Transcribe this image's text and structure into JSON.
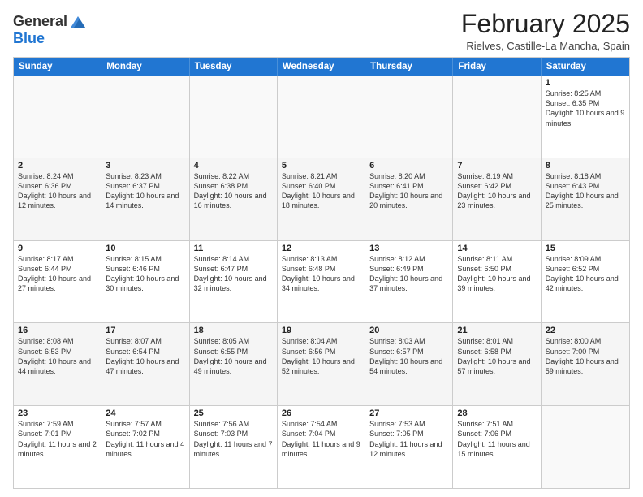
{
  "logo": {
    "general": "General",
    "blue": "Blue"
  },
  "title": "February 2025",
  "location": "Rielves, Castille-La Mancha, Spain",
  "days_of_week": [
    "Sunday",
    "Monday",
    "Tuesday",
    "Wednesday",
    "Thursday",
    "Friday",
    "Saturday"
  ],
  "weeks": [
    {
      "alt": false,
      "cells": [
        {
          "day": "",
          "empty": true,
          "text": ""
        },
        {
          "day": "",
          "empty": true,
          "text": ""
        },
        {
          "day": "",
          "empty": true,
          "text": ""
        },
        {
          "day": "",
          "empty": true,
          "text": ""
        },
        {
          "day": "",
          "empty": true,
          "text": ""
        },
        {
          "day": "",
          "empty": true,
          "text": ""
        },
        {
          "day": "1",
          "empty": false,
          "text": "Sunrise: 8:25 AM\nSunset: 6:35 PM\nDaylight: 10 hours and 9 minutes."
        }
      ]
    },
    {
      "alt": true,
      "cells": [
        {
          "day": "2",
          "empty": false,
          "text": "Sunrise: 8:24 AM\nSunset: 6:36 PM\nDaylight: 10 hours and 12 minutes."
        },
        {
          "day": "3",
          "empty": false,
          "text": "Sunrise: 8:23 AM\nSunset: 6:37 PM\nDaylight: 10 hours and 14 minutes."
        },
        {
          "day": "4",
          "empty": false,
          "text": "Sunrise: 8:22 AM\nSunset: 6:38 PM\nDaylight: 10 hours and 16 minutes."
        },
        {
          "day": "5",
          "empty": false,
          "text": "Sunrise: 8:21 AM\nSunset: 6:40 PM\nDaylight: 10 hours and 18 minutes."
        },
        {
          "day": "6",
          "empty": false,
          "text": "Sunrise: 8:20 AM\nSunset: 6:41 PM\nDaylight: 10 hours and 20 minutes."
        },
        {
          "day": "7",
          "empty": false,
          "text": "Sunrise: 8:19 AM\nSunset: 6:42 PM\nDaylight: 10 hours and 23 minutes."
        },
        {
          "day": "8",
          "empty": false,
          "text": "Sunrise: 8:18 AM\nSunset: 6:43 PM\nDaylight: 10 hours and 25 minutes."
        }
      ]
    },
    {
      "alt": false,
      "cells": [
        {
          "day": "9",
          "empty": false,
          "text": "Sunrise: 8:17 AM\nSunset: 6:44 PM\nDaylight: 10 hours and 27 minutes."
        },
        {
          "day": "10",
          "empty": false,
          "text": "Sunrise: 8:15 AM\nSunset: 6:46 PM\nDaylight: 10 hours and 30 minutes."
        },
        {
          "day": "11",
          "empty": false,
          "text": "Sunrise: 8:14 AM\nSunset: 6:47 PM\nDaylight: 10 hours and 32 minutes."
        },
        {
          "day": "12",
          "empty": false,
          "text": "Sunrise: 8:13 AM\nSunset: 6:48 PM\nDaylight: 10 hours and 34 minutes."
        },
        {
          "day": "13",
          "empty": false,
          "text": "Sunrise: 8:12 AM\nSunset: 6:49 PM\nDaylight: 10 hours and 37 minutes."
        },
        {
          "day": "14",
          "empty": false,
          "text": "Sunrise: 8:11 AM\nSunset: 6:50 PM\nDaylight: 10 hours and 39 minutes."
        },
        {
          "day": "15",
          "empty": false,
          "text": "Sunrise: 8:09 AM\nSunset: 6:52 PM\nDaylight: 10 hours and 42 minutes."
        }
      ]
    },
    {
      "alt": true,
      "cells": [
        {
          "day": "16",
          "empty": false,
          "text": "Sunrise: 8:08 AM\nSunset: 6:53 PM\nDaylight: 10 hours and 44 minutes."
        },
        {
          "day": "17",
          "empty": false,
          "text": "Sunrise: 8:07 AM\nSunset: 6:54 PM\nDaylight: 10 hours and 47 minutes."
        },
        {
          "day": "18",
          "empty": false,
          "text": "Sunrise: 8:05 AM\nSunset: 6:55 PM\nDaylight: 10 hours and 49 minutes."
        },
        {
          "day": "19",
          "empty": false,
          "text": "Sunrise: 8:04 AM\nSunset: 6:56 PM\nDaylight: 10 hours and 52 minutes."
        },
        {
          "day": "20",
          "empty": false,
          "text": "Sunrise: 8:03 AM\nSunset: 6:57 PM\nDaylight: 10 hours and 54 minutes."
        },
        {
          "day": "21",
          "empty": false,
          "text": "Sunrise: 8:01 AM\nSunset: 6:58 PM\nDaylight: 10 hours and 57 minutes."
        },
        {
          "day": "22",
          "empty": false,
          "text": "Sunrise: 8:00 AM\nSunset: 7:00 PM\nDaylight: 10 hours and 59 minutes."
        }
      ]
    },
    {
      "alt": false,
      "cells": [
        {
          "day": "23",
          "empty": false,
          "text": "Sunrise: 7:59 AM\nSunset: 7:01 PM\nDaylight: 11 hours and 2 minutes."
        },
        {
          "day": "24",
          "empty": false,
          "text": "Sunrise: 7:57 AM\nSunset: 7:02 PM\nDaylight: 11 hours and 4 minutes."
        },
        {
          "day": "25",
          "empty": false,
          "text": "Sunrise: 7:56 AM\nSunset: 7:03 PM\nDaylight: 11 hours and 7 minutes."
        },
        {
          "day": "26",
          "empty": false,
          "text": "Sunrise: 7:54 AM\nSunset: 7:04 PM\nDaylight: 11 hours and 9 minutes."
        },
        {
          "day": "27",
          "empty": false,
          "text": "Sunrise: 7:53 AM\nSunset: 7:05 PM\nDaylight: 11 hours and 12 minutes."
        },
        {
          "day": "28",
          "empty": false,
          "text": "Sunrise: 7:51 AM\nSunset: 7:06 PM\nDaylight: 11 hours and 15 minutes."
        },
        {
          "day": "",
          "empty": true,
          "text": ""
        }
      ]
    }
  ]
}
